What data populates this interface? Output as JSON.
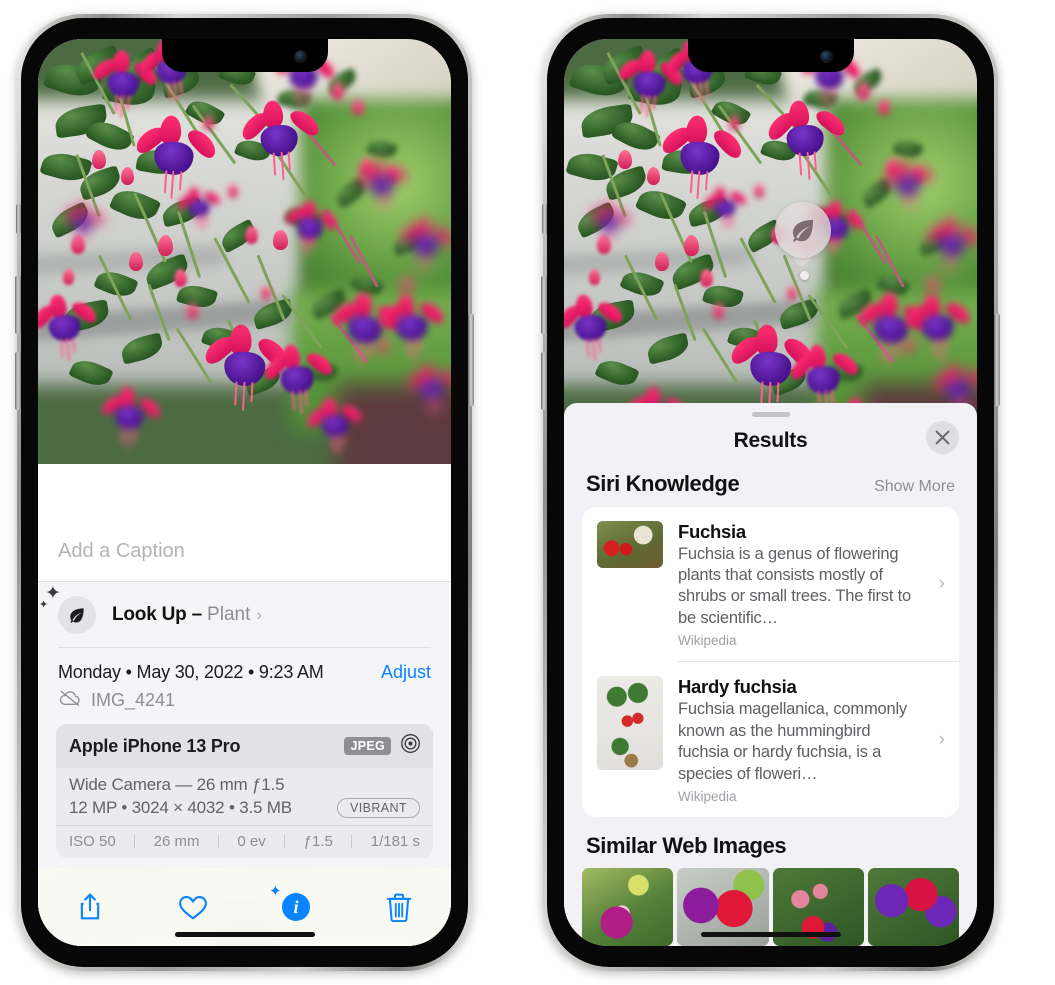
{
  "left_phone": {
    "caption_placeholder": "Add a Caption",
    "lookup": {
      "icon": "leaf-icon",
      "label": "Look Up –",
      "kind": "Plant",
      "chevron": "›"
    },
    "metadata": {
      "date": "Monday • May 30, 2022 • 9:23 AM",
      "adjust_label": "Adjust",
      "cloud_icon": "cloud-slash-icon",
      "filename": "IMG_4241"
    },
    "camera_card": {
      "model": "Apple iPhone 13 Pro",
      "format_badge": "JPEG",
      "aperture_icon": "aperture-icon",
      "lens_line": "Wide Camera — 26 mm ƒ1.5",
      "spec_line": "12 MP • 3024 × 4032 • 3.5 MB",
      "style_badge": "VIBRANT",
      "exif": [
        "ISO 50",
        "26 mm",
        "0 ev",
        "ƒ1.5",
        "1/181 s"
      ]
    },
    "toolbar": [
      {
        "name": "share-button",
        "icon": "share-icon"
      },
      {
        "name": "favorite-button",
        "icon": "heart-icon"
      },
      {
        "name": "info-button",
        "icon": "info-sparkle-icon",
        "glyph": "i"
      },
      {
        "name": "delete-button",
        "icon": "trash-icon"
      }
    ]
  },
  "right_phone": {
    "photo_badge": {
      "icon": "leaf-icon"
    },
    "sheet": {
      "title": "Results",
      "close_icon": "close-icon",
      "sections": [
        {
          "title": "Siri Knowledge",
          "action": "Show More",
          "items": [
            {
              "thumb": "fuchsia-thumbnail",
              "title": "Fuchsia",
              "description": "Fuchsia is a genus of flowering plants that consists mostly of shrubs or small trees. The first to be scientific…",
              "source": "Wikipedia",
              "chevron": "›"
            },
            {
              "thumb": "hardy-fuchsia-thumbnail",
              "title": "Hardy fuchsia",
              "description": "Fuchsia magellanica, commonly known as the hummingbird fuchsia or hardy fuchsia, is a species of floweri…",
              "source": "Wikipedia",
              "chevron": "›"
            }
          ]
        },
        {
          "title": "Similar Web Images",
          "images": [
            "web-image-1",
            "web-image-2",
            "web-image-3",
            "web-image-4"
          ]
        }
      ]
    }
  },
  "colors": {
    "accent_blue": "#0a84ff",
    "sheet_gray": "#f2f1f6",
    "card_gray": "#ebebed",
    "text_secondary": "#8e8e93"
  }
}
